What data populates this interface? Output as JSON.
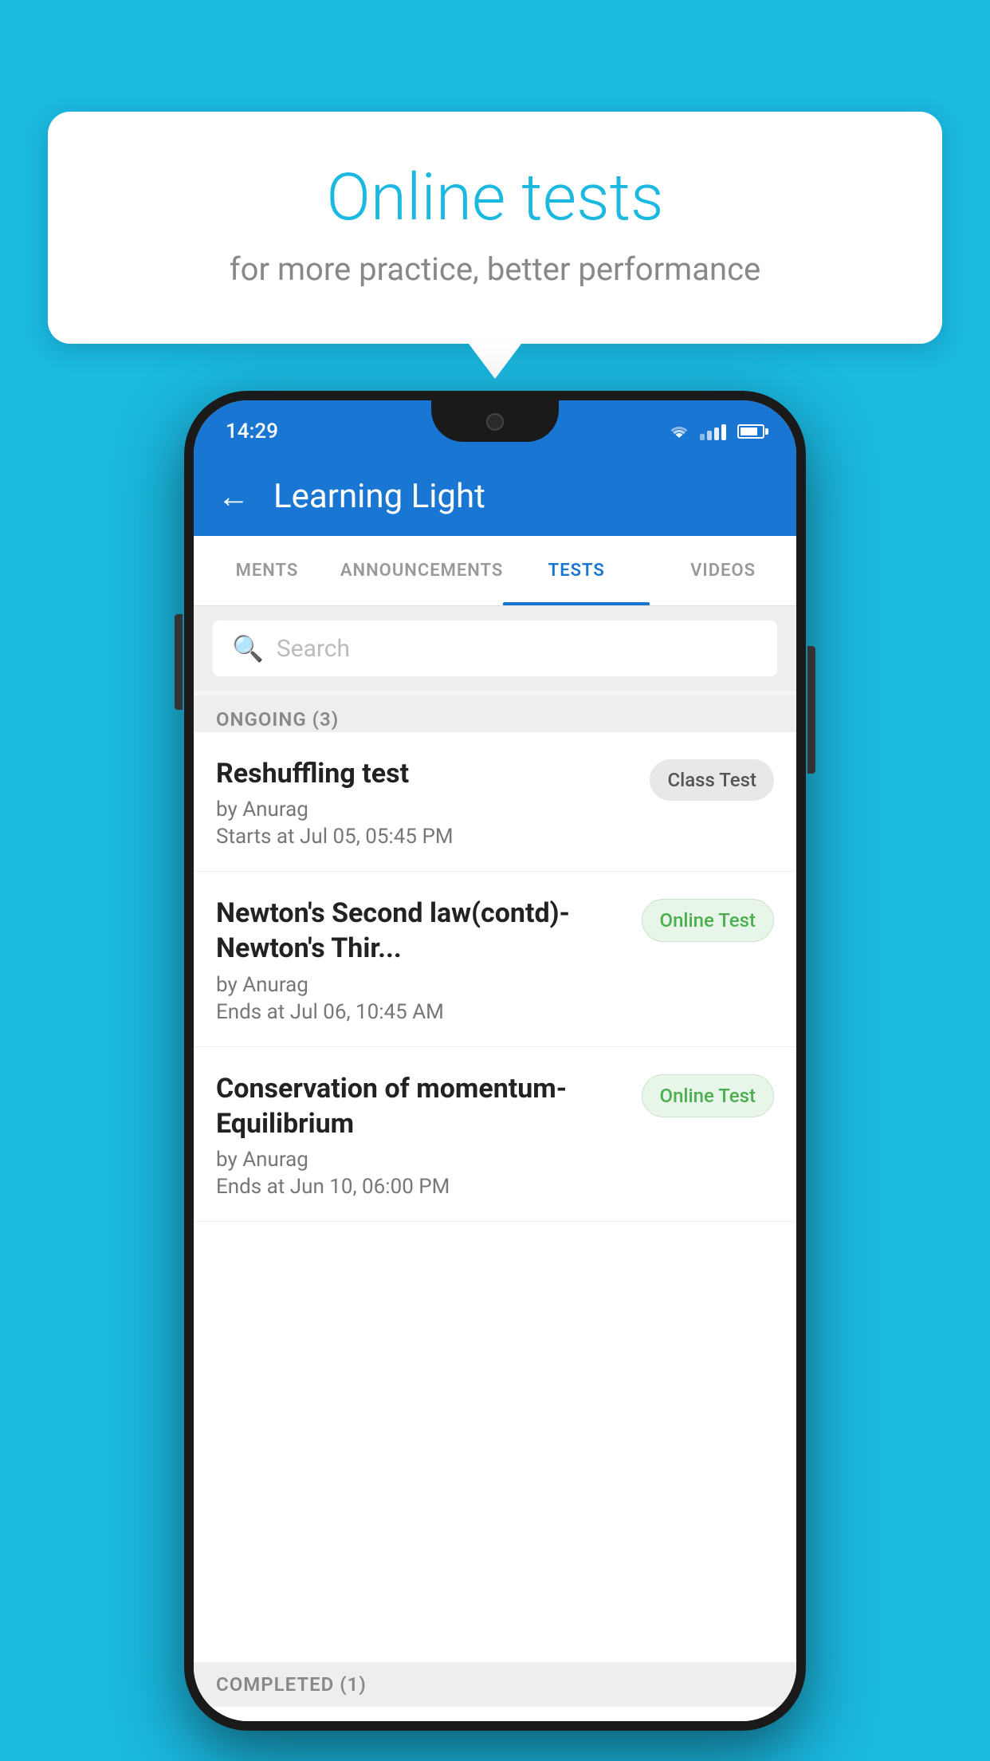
{
  "background_color": "#1bb8e0",
  "bubble": {
    "title": "Online tests",
    "subtitle": "for more practice, better performance"
  },
  "phone": {
    "status_bar": {
      "time": "14:29"
    },
    "app_bar": {
      "title": "Learning Light"
    },
    "tabs": [
      {
        "label": "MENTS",
        "active": false
      },
      {
        "label": "ANNOUNCEMENTS",
        "active": false
      },
      {
        "label": "TESTS",
        "active": true
      },
      {
        "label": "VIDEOS",
        "active": false
      }
    ],
    "search": {
      "placeholder": "Search"
    },
    "ongoing_section": {
      "title": "ONGOING (3)"
    },
    "tests": [
      {
        "name": "Reshuffling test",
        "author": "by Anurag",
        "time_label": "Starts at",
        "time_value": "Jul 05, 05:45 PM",
        "badge": "Class Test",
        "badge_type": "class"
      },
      {
        "name": "Newton's Second law(contd)-Newton's Thir...",
        "author": "by Anurag",
        "time_label": "Ends at",
        "time_value": "Jul 06, 10:45 AM",
        "badge": "Online Test",
        "badge_type": "online"
      },
      {
        "name": "Conservation of momentum-Equilibrium",
        "author": "by Anurag",
        "time_label": "Ends at",
        "time_value": "Jun 10, 06:00 PM",
        "badge": "Online Test",
        "badge_type": "online"
      }
    ],
    "completed_section": {
      "title": "COMPLETED (1)"
    }
  }
}
